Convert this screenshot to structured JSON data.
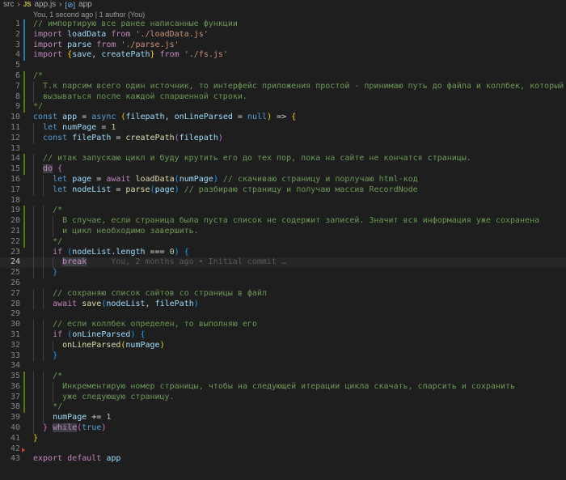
{
  "breadcrumb": {
    "folder": "src",
    "file_icon": "JS",
    "file": "app.js",
    "symbol_icon": "[⊘]",
    "symbol": "app"
  },
  "blame_header": "You, 1 second ago | 1 author (You)",
  "inline_blame": "You, 2 months ago • Initial commit …",
  "colors": {
    "added": "#587c0c",
    "modified": "#1b81a8",
    "deleted": "#c24038"
  },
  "lines": [
    {
      "n": "1",
      "t": "// импортирую все ранее написанные функции"
    },
    {
      "n": "2",
      "t": "import loadData from './loadData.js'"
    },
    {
      "n": "3",
      "t": "import parse from './parse.js'"
    },
    {
      "n": "4",
      "t": "import {save, createPath} from './fs.js'"
    },
    {
      "n": "5",
      "t": ""
    },
    {
      "n": "6",
      "t": "/*"
    },
    {
      "n": "7",
      "t": "  Т.к парсим всего один источник, то интерфейс приложения простой - принимаю путь до файла и коллбек, который будет"
    },
    {
      "n": "8",
      "t": "  вызываться после каждой спаршенной строки."
    },
    {
      "n": "9",
      "t": "*/"
    },
    {
      "n": "10",
      "t": "const app = async (filepath, onLineParsed = null) => {"
    },
    {
      "n": "11",
      "t": "  let numPage = 1"
    },
    {
      "n": "12",
      "t": "  const filePath = createPath(filepath)"
    },
    {
      "n": "13",
      "t": ""
    },
    {
      "n": "14",
      "t": "  // итак запускаю цикл и буду крутить его до тех пор, пока на сайте не кончатся страницы."
    },
    {
      "n": "15",
      "t": "  do {"
    },
    {
      "n": "16",
      "t": "    let page = await loadData(numPage) // скачиваю страницу и порлучаю html-код"
    },
    {
      "n": "17",
      "t": "    let nodeList = parse(page) // разбираю страницу и получаю массив RecordNode"
    },
    {
      "n": "18",
      "t": ""
    },
    {
      "n": "19",
      "t": "    /*"
    },
    {
      "n": "20",
      "t": "      В случае, если страница была пуста список не содержит записей. Значит вся информация уже сохранена"
    },
    {
      "n": "21",
      "t": "      и цикл необходимо завершить."
    },
    {
      "n": "22",
      "t": "    */"
    },
    {
      "n": "23",
      "t": "    if (nodeList.length === 0) {"
    },
    {
      "n": "24",
      "t": "      break"
    },
    {
      "n": "25",
      "t": "    }"
    },
    {
      "n": "26",
      "t": ""
    },
    {
      "n": "27",
      "t": "    // сохраняю список сайтов со страницы в файл"
    },
    {
      "n": "28",
      "t": "    await save(nodeList, filePath)"
    },
    {
      "n": "29",
      "t": ""
    },
    {
      "n": "30",
      "t": "    // если коллбек определен, то выполняю его"
    },
    {
      "n": "31",
      "t": "    if (onLineParsed) {"
    },
    {
      "n": "32",
      "t": "      onLineParsed(numPage)"
    },
    {
      "n": "33",
      "t": "    }"
    },
    {
      "n": "34",
      "t": ""
    },
    {
      "n": "35",
      "t": "    /*"
    },
    {
      "n": "36",
      "t": "      Инкрементирую номер страницы, чтобы на следующей итерации цикла скачать, спарсить и сохранить"
    },
    {
      "n": "37",
      "t": "      уже следующую страницу."
    },
    {
      "n": "38",
      "t": "    */"
    },
    {
      "n": "39",
      "t": "    numPage += 1"
    },
    {
      "n": "40",
      "t": "  } while(true)"
    },
    {
      "n": "41",
      "t": "}"
    },
    {
      "n": "42",
      "t": ""
    },
    {
      "n": "43",
      "t": "export default app"
    }
  ]
}
